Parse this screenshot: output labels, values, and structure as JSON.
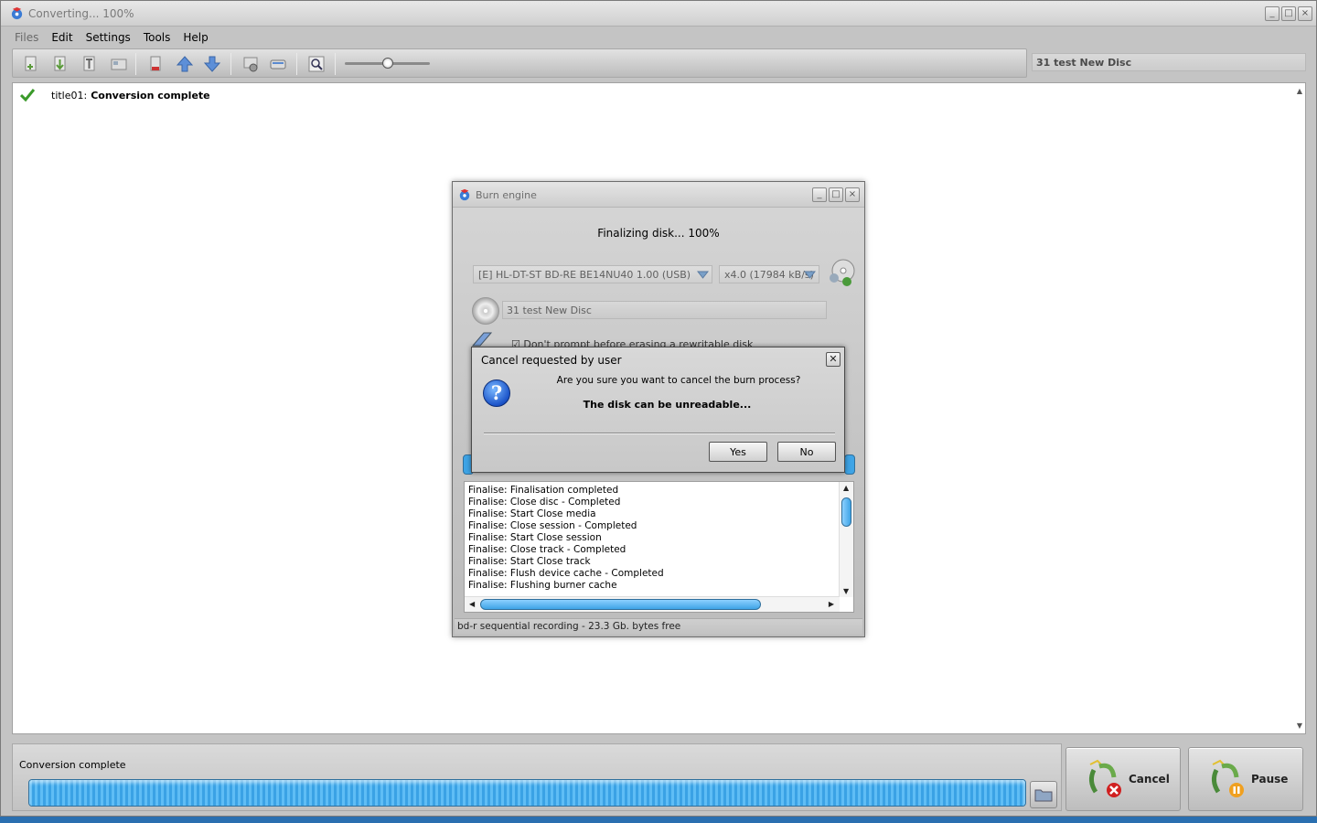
{
  "window": {
    "title": "Converting... 100%",
    "controls": {
      "minimize": "_",
      "maximize": "□",
      "close": "×"
    }
  },
  "menu": {
    "items": [
      {
        "label": "Files",
        "enabled": false
      },
      {
        "label": "Edit",
        "enabled": true
      },
      {
        "label": "Settings",
        "enabled": true
      },
      {
        "label": "Tools",
        "enabled": true
      },
      {
        "label": "Help",
        "enabled": true
      }
    ]
  },
  "toolbar": {
    "buttons": [
      "add-file-icon",
      "import-icon",
      "add-title-icon",
      "add-menu-icon",
      "remove-icon",
      "move-up-icon",
      "move-down-icon",
      "settings-icon",
      "burn-icon",
      "preview-icon"
    ],
    "zoom_slider_value": 0.5,
    "disc_name": "31 test New Disc"
  },
  "content": {
    "rows": [
      {
        "title": "title01:",
        "status": "Conversion complete"
      }
    ]
  },
  "bottom": {
    "status": "Conversion complete",
    "progress": 1.0,
    "cancel_label": "Cancel",
    "pause_label": "Pause"
  },
  "burn_dialog": {
    "title": "Burn engine",
    "progress_text": "Finalizing disk... 100%",
    "drive": "[E] HL-DT-ST BD-RE  BE14NU40 1.00 (USB)",
    "speed": "x4.0 (17984 kB/s)",
    "disc_label": "31 test New Disc",
    "option_text": "Don't prompt before erasing a rewritable disk",
    "log": [
      "Finalise: Finalisation completed",
      "Finalise: Close disc - Completed",
      "Finalise: Start Close media",
      "Finalise: Close session - Completed",
      "Finalise: Start Close session",
      "Finalise: Close track - Completed",
      "Finalise: Start Close track",
      "Finalise: Flush device cache - Completed",
      "Finalise: Flushing burner cache"
    ],
    "status": "bd-r sequential recording - 23.3 Gb. bytes free"
  },
  "confirm_dialog": {
    "title": "Cancel requested by user",
    "close": "✕",
    "icon": "?",
    "message": "Are you sure you want to cancel the burn process?",
    "warning": "The disk can be unreadable...",
    "yes_label": "Yes",
    "no_label": "No"
  },
  "colors": {
    "progress_blue": "#3ea4e6",
    "checkmark_green": "#3a9a2a",
    "cancel_red": "#d02020",
    "pause_orange": "#f0a020"
  }
}
